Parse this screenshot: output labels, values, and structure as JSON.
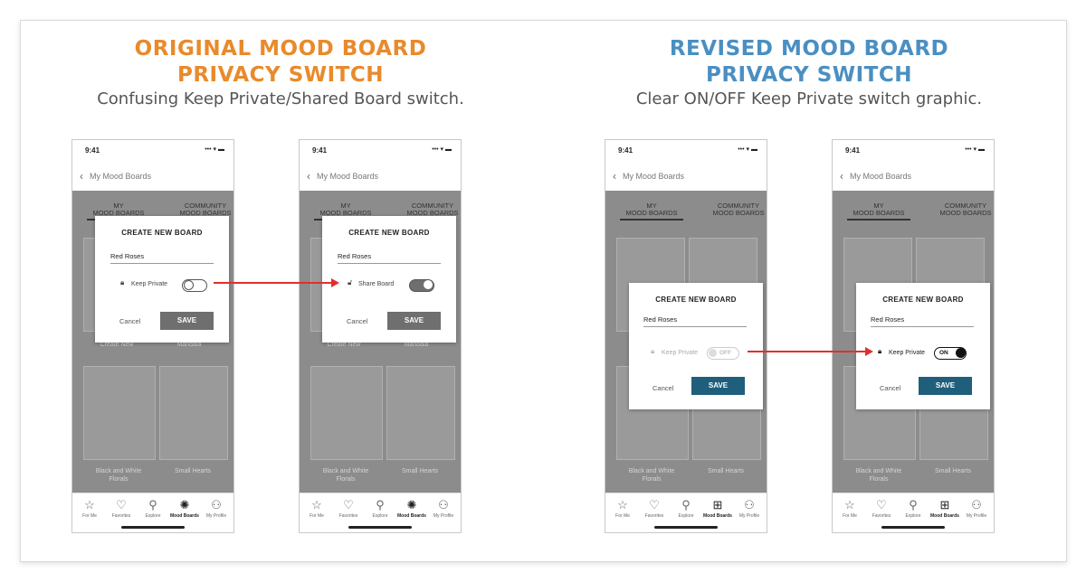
{
  "colors": {
    "orange": "#e98a2b",
    "blue": "#4a8fc2",
    "save_gray": "#6f6f6f",
    "save_teal": "#1f5f7c",
    "arrow": "#e0302b"
  },
  "left": {
    "title_line1": "ORIGINAL MOOD BOARD",
    "title_line2": "PRIVACY SWITCH",
    "subtitle": "Confusing Keep Private/Shared Board switch."
  },
  "right": {
    "title_line1": "REVISED MOOD BOARD",
    "title_line2": "PRIVACY SWITCH",
    "subtitle": "Clear ON/OFF Keep Private switch graphic."
  },
  "phone": {
    "time": "9:41",
    "status_icons": "••• ▾ ▬",
    "back_label": "My Mood Boards",
    "tab_my": "MY MOOD BOARDS",
    "tab_my_line1": "MY",
    "tab_my_line2": "MOOD BOARDS",
    "tab_community_line1": "COMMUNITY",
    "tab_community_line2": "MOOD BOARDS",
    "tile_create_new": "Create New",
    "tile_mandala": "Mandala",
    "tile_black_white_line1": "Black and White",
    "tile_black_white_line2": "Florals",
    "tile_small_hearts": "Small Hearts",
    "tabbar": [
      {
        "label": "For Me",
        "icon": "star-icon"
      },
      {
        "label": "Favorites",
        "icon": "heart-icon"
      },
      {
        "label": "Explore",
        "icon": "search-icon"
      },
      {
        "label": "Mood Boards",
        "icon": "lightbulb-icon"
      },
      {
        "label": "My Profile",
        "icon": "person-icon"
      }
    ]
  },
  "modal": {
    "title": "CREATE NEW BOARD",
    "field_value": "Red Roses",
    "keep_private": "Keep Private",
    "share_board": "Share Board",
    "cancel": "Cancel",
    "save": "SAVE",
    "off": "OFF",
    "on": "ON"
  }
}
